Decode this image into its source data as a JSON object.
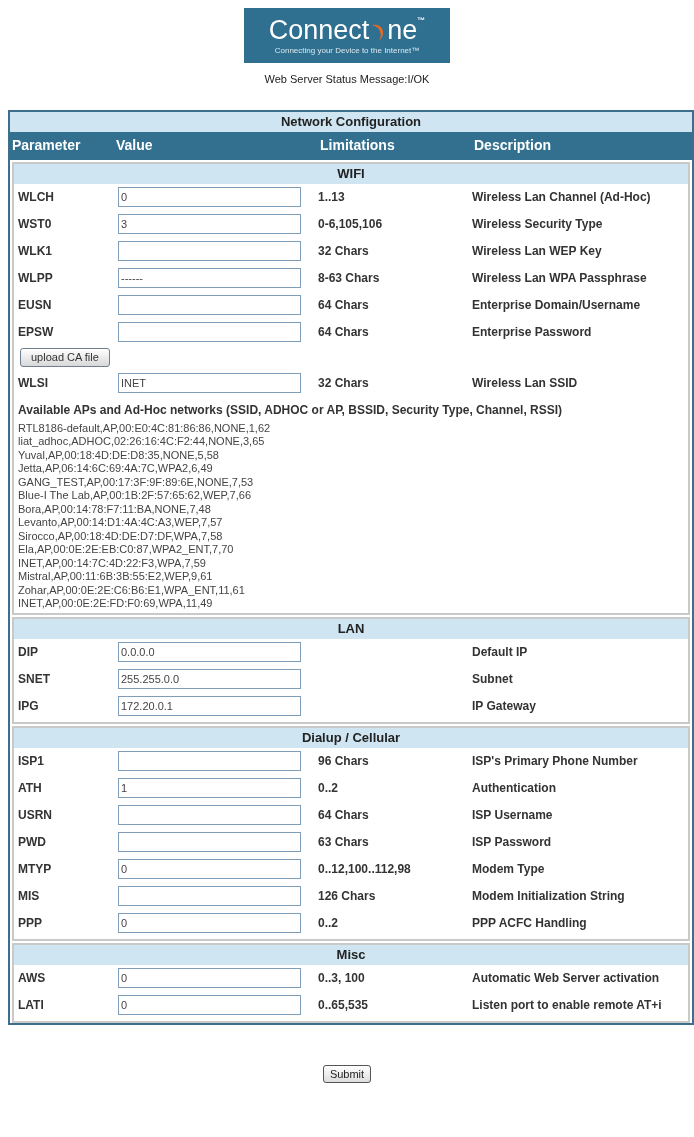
{
  "logo": {
    "word_start": "Connect",
    "word_end": "ne",
    "trademark": "™",
    "tagline": "Connecting your Device to the Internet™"
  },
  "status_message": "Web Server Status Message:I/OK",
  "table": {
    "title": "Network Configuration",
    "columns": [
      "Parameter",
      "Value",
      "Limitations",
      "Description"
    ],
    "sections": [
      {
        "title": "WIFI",
        "rows": [
          {
            "kind": "field",
            "parameter": "WLCH",
            "value": "0",
            "limitations": "1..13",
            "description": "Wireless Lan Channel (Ad-Hoc)"
          },
          {
            "kind": "field",
            "parameter": "WST0",
            "value": "3",
            "limitations": "0-6,105,106",
            "description": "Wireless Security Type"
          },
          {
            "kind": "field",
            "parameter": "WLK1",
            "limitations": "32 Chars",
            "description": "Wireless Lan WEP Key"
          },
          {
            "kind": "field",
            "parameter": "WLPP",
            "value": "------",
            "limitations": "8-63 Chars",
            "description": "Wireless Lan WPA Passphrase"
          },
          {
            "kind": "field",
            "parameter": "EUSN",
            "limitations": "64 Chars",
            "description": "Enterprise Domain/Username"
          },
          {
            "kind": "field",
            "parameter": "EPSW",
            "limitations": "64 Chars",
            "description": "Enterprise Password"
          },
          {
            "kind": "button",
            "label": "upload CA file"
          },
          {
            "kind": "field",
            "parameter": "WLSI",
            "value": "INET",
            "limitations": "32 Chars",
            "description": "Wireless Lan SSID"
          },
          {
            "kind": "list",
            "heading": "Available APs and Ad-Hoc networks (SSID, ADHOC or AP, BSSID, Security Type, Channel, RSSI)",
            "lines": [
              "RTL8186-default,AP,00:E0:4C:81:86:86,NONE,1,62",
              "liat_adhoc,ADHOC,02:26:16:4C:F2:44,NONE,3,65",
              "Yuval,AP,00:18:4D:DE:D8:35,NONE,5,58",
              "Jetta,AP,06:14:6C:69:4A:7C,WPA2,6,49",
              "GANG_TEST,AP,00:17:3F:9F:89:6E,NONE,7,53",
              "Blue-I The Lab,AP,00:1B:2F:57:65:62,WEP,7,66",
              "Bora,AP,00:14:78:F7:11:BA,NONE,7,48",
              "Levanto,AP,00:14:D1:4A:4C:A3,WEP,7,57",
              "Sirocco,AP,00:18:4D:DE:D7:DF,WPA,7,58",
              "Ela,AP,00:0E:2E:EB:C0:87,WPA2_ENT,7,70",
              "INET,AP,00:14:7C:4D:22:F3,WPA,7,59",
              "Mistral,AP,00:11:6B:3B:55:E2,WEP,9,61",
              "Zohar,AP,00:0E:2E:C6:B6:E1,WPA_ENT,11,61",
              "INET,AP,00:0E:2E:FD:F0:69,WPA,11,49"
            ]
          }
        ]
      },
      {
        "title": "LAN",
        "rows": [
          {
            "kind": "field",
            "parameter": "DIP",
            "value": "0.0.0.0",
            "description": "Default IP"
          },
          {
            "kind": "field",
            "parameter": "SNET",
            "value": "255.255.0.0",
            "description": "Subnet"
          },
          {
            "kind": "field",
            "parameter": "IPG",
            "value": "172.20.0.1",
            "description": "IP Gateway"
          }
        ]
      },
      {
        "title": "Dialup / Cellular",
        "rows": [
          {
            "kind": "field",
            "parameter": "ISP1",
            "limitations": "96 Chars",
            "description": "ISP's Primary Phone Number"
          },
          {
            "kind": "field",
            "parameter": "ATH",
            "value": "1",
            "limitations": "0..2",
            "description": "Authentication"
          },
          {
            "kind": "field",
            "parameter": "USRN",
            "limitations": "64 Chars",
            "description": "ISP Username"
          },
          {
            "kind": "field",
            "parameter": "PWD",
            "limitations": "63 Chars",
            "description": "ISP Password"
          },
          {
            "kind": "field",
            "parameter": "MTYP",
            "value": "0",
            "limitations": "0..12,100..112,98",
            "description": "Modem Type"
          },
          {
            "kind": "field",
            "parameter": "MIS",
            "limitations": "126 Chars",
            "description": "Modem Initialization String"
          },
          {
            "kind": "field",
            "parameter": "PPP",
            "value": "0",
            "limitations": "0..2",
            "description": "PPP ACFC Handling"
          }
        ]
      },
      {
        "title": "Misc",
        "rows": [
          {
            "kind": "field",
            "parameter": "AWS",
            "value": "0",
            "limitations": "0..3, 100",
            "description": "Automatic Web Server activation"
          },
          {
            "kind": "field",
            "parameter": "LATI",
            "value": "0",
            "limitations": "0..65,535",
            "description": "Listen port to enable remote AT+i"
          }
        ]
      }
    ]
  },
  "submit": "Submit"
}
